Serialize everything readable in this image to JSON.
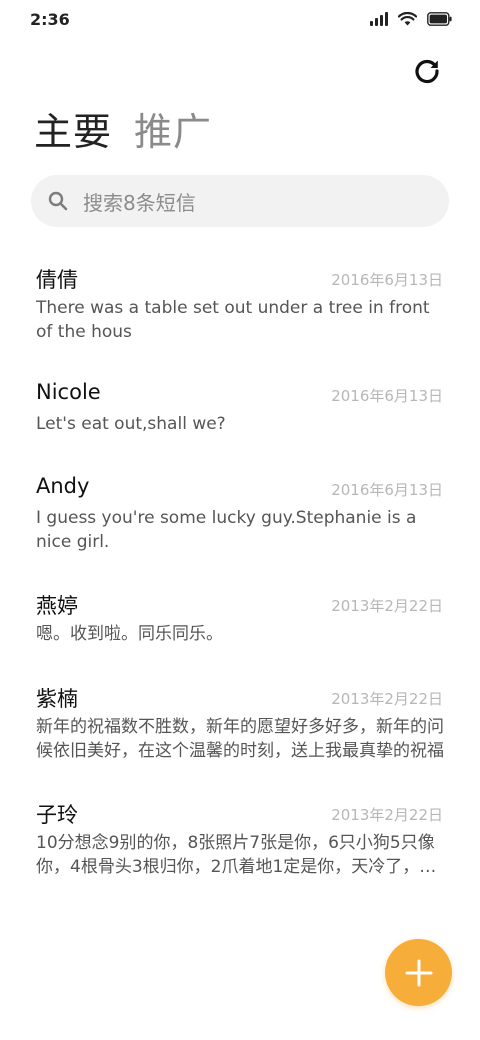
{
  "status_bar": {
    "time": "2:36"
  },
  "header": {
    "refresh_icon": "refresh-icon"
  },
  "tabs": [
    {
      "label": "主要",
      "active": true
    },
    {
      "label": "推广",
      "active": false
    }
  ],
  "search": {
    "placeholder": "搜索8条短信",
    "icon": "search-icon"
  },
  "conversations": [
    {
      "name": "倩倩",
      "date": "2016年6月13日",
      "preview": "There was a table set out under a tree in front of the hous"
    },
    {
      "name": "Nicole",
      "date": "2016年6月13日",
      "preview": "Let's eat out,shall we?"
    },
    {
      "name": "Andy",
      "date": "2016年6月13日",
      "preview": "I guess you're some lucky guy.Stephanie is a nice girl."
    },
    {
      "name": "燕婷",
      "date": "2013年2月22日",
      "preview": "嗯。收到啦。同乐同乐。"
    },
    {
      "name": "紫楠",
      "date": "2013年2月22日",
      "preview": "新年的祝福数不胜数，新年的愿望好多好多，新年的问候依旧美好，在这个温馨的时刻，送上我最真挚的祝福"
    },
    {
      "name": "子玲",
      "date": "2013年2月22日",
      "preview": "10分想念9别的你，8张照片7张是你，6只小狗5只像你，4根骨头3根归你，2爪着地1定是你，天冷了，注意保暖"
    }
  ],
  "fab": {
    "icon": "plus-icon",
    "color": "#f6ad3a"
  },
  "colors": {
    "accent": "#f6ad3a",
    "date_text": "#b7b7b7",
    "inactive_tab": "#8a8a8a"
  }
}
